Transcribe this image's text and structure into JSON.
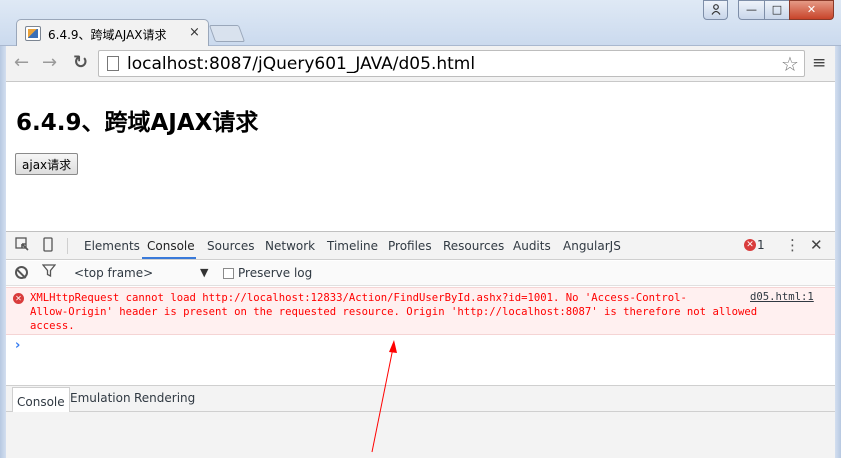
{
  "window": {
    "user_icon": "user-icon",
    "minimize_glyph": "—",
    "maximize_glyph": "□",
    "close_glyph": "✕"
  },
  "tab": {
    "title": "6.4.9、跨域AJAX请求",
    "close_glyph": "×"
  },
  "toolbar": {
    "back_glyph": "←",
    "forward_glyph": "→",
    "reload_glyph": "↻",
    "url": "localhost:8087/jQuery601_JAVA/d05.html",
    "star_glyph": "☆",
    "menu_glyph": "≡"
  },
  "page": {
    "heading": "6.4.9、跨域AJAX请求",
    "button_label": "ajax请求"
  },
  "devtools": {
    "inspect_glyph": "⬚",
    "device_glyph": "▯",
    "tabs": [
      "Elements",
      "Console",
      "Sources",
      "Network",
      "Timeline",
      "Profiles",
      "Resources",
      "Audits",
      "AngularJS"
    ],
    "active_tab": "Console",
    "error_count": "1",
    "more_glyph": "⋮",
    "close_glyph": "✕",
    "console_toolbar": {
      "filter_glyph": "⛉",
      "frame_selector": "<top frame>",
      "frame_arrow": "▼",
      "preserve_log_label": "Preserve log"
    },
    "console": {
      "error_lines": [
        "XMLHttpRequest cannot load http://localhost:12833/Action/FindUserById.ashx?id=1001. No 'Access-Control-",
        "Allow-Origin' header is present on the requested resource. Origin 'http://localhost:8087' is therefore not allowed",
        "access."
      ],
      "error_source": "d05.html:1",
      "prompt_glyph": "›"
    },
    "drawer_tabs": [
      "Console",
      "Emulation",
      "Rendering"
    ]
  },
  "colors": {
    "error_text": "#ff0000",
    "error_background": "#fff0f0",
    "annotation_arrow": "#ff0000",
    "active_tab_underline": "#3879d9"
  }
}
